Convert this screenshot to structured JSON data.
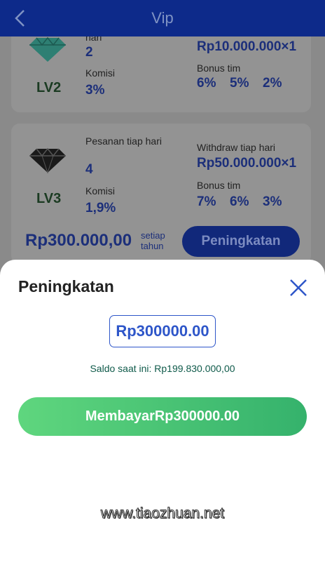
{
  "header": {
    "title": "Vip"
  },
  "card_lv2": {
    "level": "LV2",
    "orders_label_partial": "hari",
    "orders_value": "2",
    "commission_label": "Komisi",
    "commission_value": "3%",
    "withdraw_value": "Rp10.000.000×1",
    "bonus_label": "Bonus tim",
    "bonus_values": [
      "6%",
      "5%",
      "2%"
    ]
  },
  "card_lv3": {
    "level": "LV3",
    "orders_label": "Pesanan tiap hari",
    "orders_value": "4",
    "commission_label": "Komisi",
    "commission_value": "1,9%",
    "withdraw_label": "Withdraw tiap hari",
    "withdraw_value": "Rp50.000.000×1",
    "bonus_label": "Bonus tim",
    "bonus_values": [
      "7%",
      "6%",
      "3%"
    ],
    "price": "Rp300.000,00",
    "per_label": "setiap tahun",
    "upgrade_label": "Peningkatan"
  },
  "sheet": {
    "title": "Peningkatan",
    "amount": "Rp300000.00",
    "balance_text": "Saldo saat ini: Rp199.830.000,00",
    "pay_label": "MembayarRp300000.00"
  },
  "watermark": "www.tiaozhuan.net",
  "colors": {
    "header": "#0d2a8a",
    "accent": "#2e56c9",
    "pay_start": "#5fd67e",
    "pay_end": "#35b26c"
  }
}
